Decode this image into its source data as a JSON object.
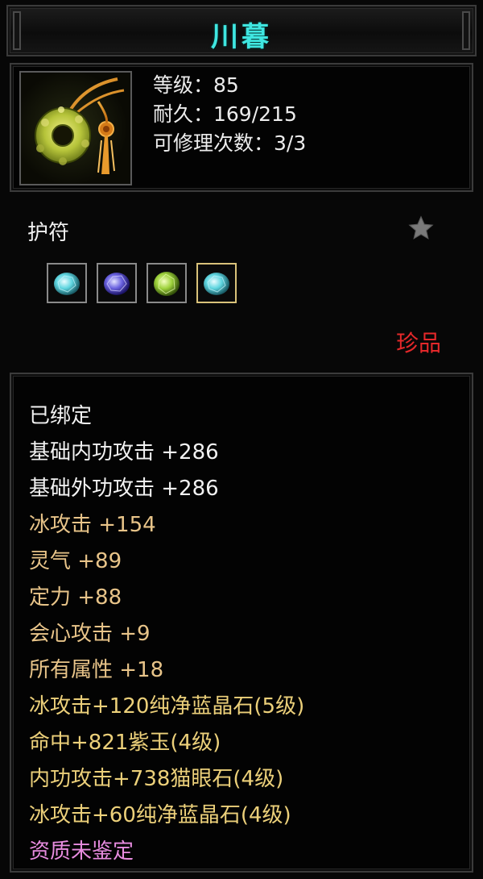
{
  "item": {
    "name": "川暮",
    "image_icon": "jade-ring-amulet-icon"
  },
  "stats": {
    "level": "等级：85",
    "durability": "耐久：169/215",
    "repairs": "可修理次数：3/3"
  },
  "category": {
    "label": "护符",
    "favorite_icon": "star-icon"
  },
  "gems": [
    {
      "icon": "blue-crystal-gem-icon",
      "color": "#5fd6e0"
    },
    {
      "icon": "purple-jade-gem-icon",
      "color": "#7a7ae8"
    },
    {
      "icon": "cat-eye-gem-icon",
      "color": "#9ed23c"
    },
    {
      "icon": "blue-crystal-gem-icon",
      "color": "#5fd6e0"
    }
  ],
  "rarity": {
    "label": "珍品",
    "color": "#e4282a"
  },
  "attributes": [
    {
      "text": "已绑定",
      "style": "white"
    },
    {
      "text": "基础内功攻击  +286",
      "style": "white"
    },
    {
      "text": "基础外功攻击  +286",
      "style": "white"
    },
    {
      "text": "冰攻击  +154",
      "style": "gold"
    },
    {
      "text": "灵气  +89",
      "style": "gold"
    },
    {
      "text": "定力  +88",
      "style": "gold"
    },
    {
      "text": "会心攻击  +9",
      "style": "gold"
    },
    {
      "text": "所有属性  +18",
      "style": "gold"
    },
    {
      "text": "冰攻击+120纯净蓝晶石(5级)",
      "style": "gem"
    },
    {
      "text": "命中+821紫玉(4级)",
      "style": "gem"
    },
    {
      "text": "内功攻击+738猫眼石(4级)",
      "style": "gem"
    },
    {
      "text": "冰攻击+60纯净蓝晶石(4级)",
      "style": "gem"
    },
    {
      "text": "资质未鉴定",
      "style": "pink"
    }
  ],
  "colors": {
    "title": "#3fe6e0",
    "white": "#f2f2f2",
    "gold": "#e8c489",
    "gem": "#ecd07a",
    "pink": "#e88ce0"
  }
}
